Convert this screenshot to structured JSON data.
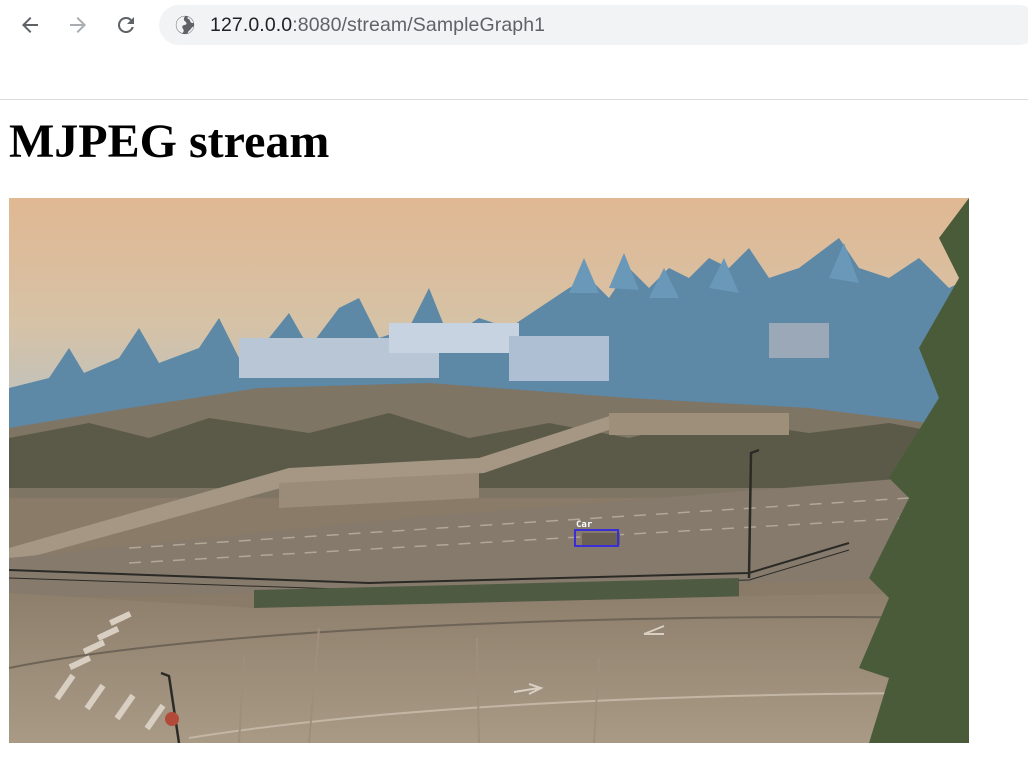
{
  "browser": {
    "url_host": "127.0.0.0",
    "url_rest": ":8080/stream/SampleGraph1",
    "icons": {
      "back": "arrow-left-icon",
      "forward": "arrow-right-icon",
      "reload": "reload-icon",
      "site": "globe-icon"
    }
  },
  "page": {
    "heading": "MJPEG stream"
  },
  "stream": {
    "detections": [
      {
        "label": "Car"
      }
    ]
  },
  "colors": {
    "detection_box": "#3a2fd6",
    "chrome_bg": "#f1f3f4"
  }
}
